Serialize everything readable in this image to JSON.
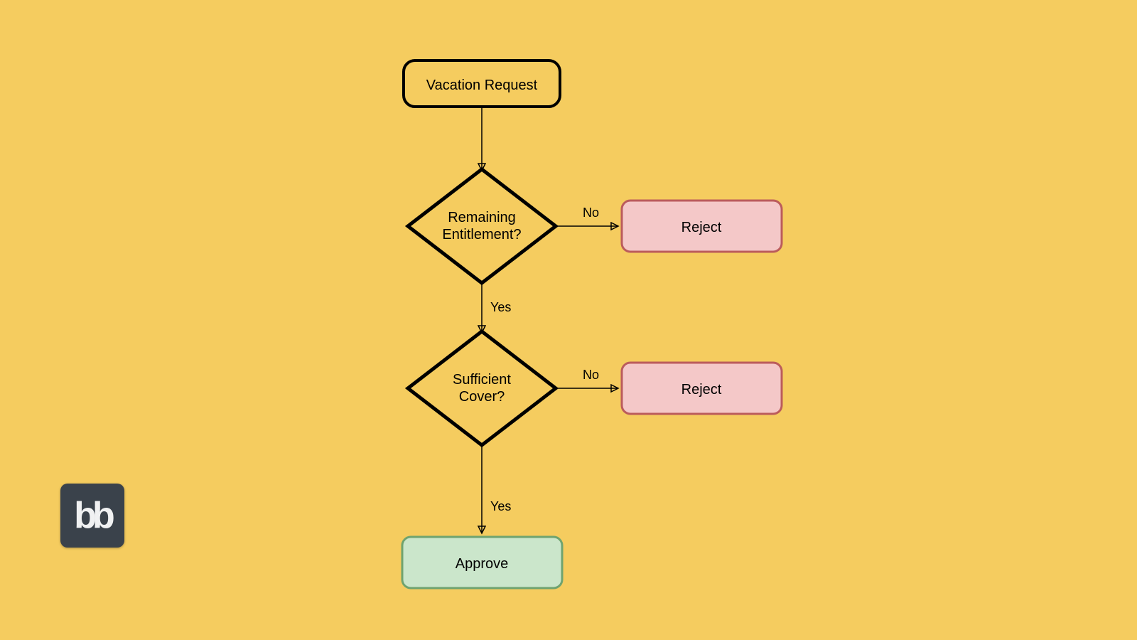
{
  "diagram": {
    "type": "flowchart",
    "nodes": {
      "start": {
        "label": "Vacation Request",
        "shape": "rounded-rect",
        "fill": "transparent"
      },
      "dec1": {
        "label_l1": "Remaining",
        "label_l2": "Entitlement?",
        "shape": "diamond"
      },
      "dec2": {
        "label_l1": "Sufficient",
        "label_l2": "Cover?",
        "shape": "diamond"
      },
      "reject1": {
        "label": "Reject",
        "shape": "rounded-rect",
        "fill": "#f4c8c8",
        "stroke": "#bb5c5c"
      },
      "reject2": {
        "label": "Reject",
        "shape": "rounded-rect",
        "fill": "#f4c8c8",
        "stroke": "#bb5c5c"
      },
      "approve": {
        "label": "Approve",
        "shape": "rounded-rect",
        "fill": "#cbe6cb",
        "stroke": "#6fa36f"
      }
    },
    "edges": {
      "start_dec1": {
        "from": "start",
        "to": "dec1",
        "label": ""
      },
      "dec1_reject1": {
        "from": "dec1",
        "to": "reject1",
        "label": "No"
      },
      "dec1_dec2": {
        "from": "dec1",
        "to": "dec2",
        "label": "Yes"
      },
      "dec2_reject2": {
        "from": "dec2",
        "to": "reject2",
        "label": "No"
      },
      "dec2_approve": {
        "from": "dec2",
        "to": "approve",
        "label": "Yes"
      }
    }
  },
  "logo": {
    "text": "bb"
  },
  "colors": {
    "background": "#f5cc5f",
    "reject_fill": "#f4c8c8",
    "reject_stroke": "#bb5c5c",
    "approve_fill": "#cbe6cb",
    "approve_stroke": "#6fa36f",
    "node_stroke": "#000000"
  }
}
